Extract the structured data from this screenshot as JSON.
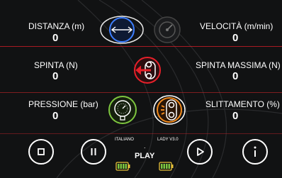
{
  "metrics": {
    "distanza": {
      "label": "DISTANZA (m)",
      "value": "0"
    },
    "velocita": {
      "label": "VELOCITÀ (m/min)",
      "value": "0"
    },
    "spinta": {
      "label": "SPINTA (N)",
      "value": "0"
    },
    "spinta_massima": {
      "label": "SPINTA MASSIMA (N)",
      "value": "0"
    },
    "pressione": {
      "label": "PRESSIONE (bar)",
      "value": "0"
    },
    "slittamento": {
      "label": "SLITTAMENTO (%)",
      "value": "0"
    }
  },
  "footer": {
    "language": "ITALIANO",
    "version": "LADY V3.0",
    "status": "PLAY",
    "dot": "."
  },
  "colors": {
    "blue": "#3d7fff",
    "red": "#e8202a",
    "green": "#7ec63f",
    "orange": "#f08a1e",
    "background": "#111213"
  },
  "icons": [
    "double-arrow-icon",
    "speedometer-icon",
    "push-force-icon",
    "pressure-gauge-icon",
    "slip-icon",
    "stop-icon",
    "pause-icon",
    "play-icon",
    "info-icon",
    "battery-icon"
  ]
}
